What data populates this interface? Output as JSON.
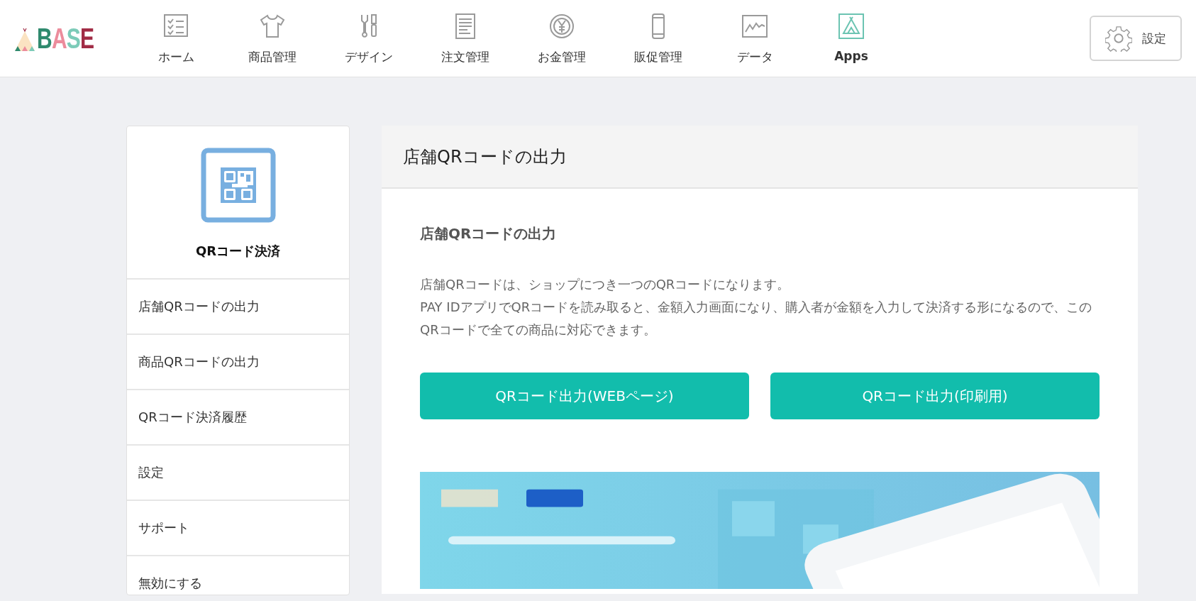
{
  "header": {
    "logo": "BASE",
    "nav": [
      {
        "label": "ホーム",
        "selected": false
      },
      {
        "label": "商品管理",
        "selected": false
      },
      {
        "label": "デザイン",
        "selected": false
      },
      {
        "label": "注文管理",
        "selected": false
      },
      {
        "label": "お金管理",
        "selected": false
      },
      {
        "label": "販促管理",
        "selected": false
      },
      {
        "label": "データ",
        "selected": false
      },
      {
        "label": "Apps",
        "selected": true
      }
    ],
    "settings_button": "設定"
  },
  "sidebar": {
    "app_name": "QRコード決済",
    "items": [
      "店舗QRコードの出力",
      "商品QRコードの出力",
      "QRコード決済履歴",
      "設定",
      "サポート",
      "無効にする"
    ]
  },
  "main": {
    "panel_title": "店舗QRコードの出力",
    "section_title": "店舗QRコードの出力",
    "description": [
      "店舗QRコードは、ショップにつき一つのQRコードになります。",
      "PAY IDアプリでQRコードを読み取ると、金額入力画面になり、購入者が金額を入力して決済する形になるので、このQRコードで全ての商品に対応できます。"
    ],
    "buttons": [
      "QRコード出力(WEBページ)",
      "QRコード出力(印刷用)"
    ]
  }
}
